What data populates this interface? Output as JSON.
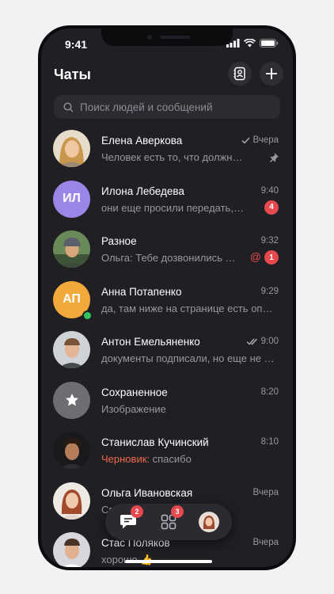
{
  "status": {
    "time": "9:41"
  },
  "header": {
    "title": "Чаты"
  },
  "search": {
    "placeholder": "Поиск людей и сообщений"
  },
  "colors": {
    "accent_red": "#e5484d",
    "draft": "#ee6a4f",
    "online": "#32c45a",
    "background": "#1f1f24"
  },
  "chats": [
    {
      "name": "Елена Аверкова",
      "message": "Человек есть то, что должно быть",
      "time": "Вчера",
      "status_icon": "check-icon",
      "pinned": true
    },
    {
      "name": "Илона Лебедева",
      "initials": "ИЛ",
      "message": "они еще просили передать, что",
      "time": "9:40",
      "badge": "4"
    },
    {
      "name": "Разное",
      "message": "Ольга: Тебе дозвонились из офиса?",
      "time": "9:32",
      "badge": "1",
      "mention": "@"
    },
    {
      "name": "Анна Потапенко",
      "initials": "АП",
      "message": "да, там ниже на странице есть описание",
      "time": "9:29",
      "online": true
    },
    {
      "name": "Антон Емельяненко",
      "message": "документы подписали, но еще не отправили",
      "time": "9:00",
      "status_icon": "double-check-icon"
    },
    {
      "name": "Сохраненное",
      "message": "Изображение",
      "time": "8:20"
    },
    {
      "name": "Станислав Кучинский",
      "draft_label": "Черновик:",
      "message": "спасибо",
      "time": "8:10"
    },
    {
      "name": "Ольга Ивановская",
      "message": "Спасибо, что можно пр...",
      "time": "Вчера"
    },
    {
      "name": "Стас Поляков",
      "message": "хорошо 👍",
      "time": "Вчера"
    }
  ],
  "tabbar": {
    "chats_badge": "2",
    "apps_badge": "3"
  }
}
